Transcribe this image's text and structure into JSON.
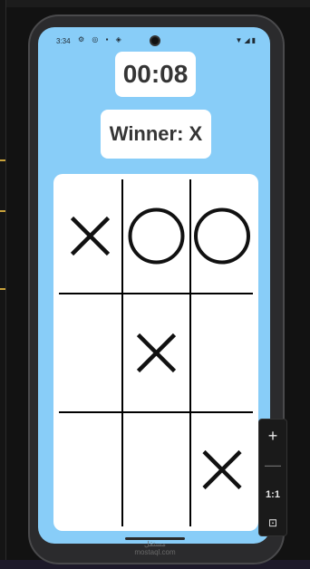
{
  "status_bar": {
    "time": "3:34"
  },
  "game": {
    "timer": "00:08",
    "winner": "Winner: X",
    "board": [
      [
        "X",
        "O",
        "O"
      ],
      [
        "",
        "X",
        ""
      ],
      [
        "",
        "",
        "X"
      ]
    ]
  },
  "watermark": "مستقل\nmostaql.com",
  "zoom_panel": {
    "ratio_label": "1:1"
  },
  "colors": {
    "screen_bg": "#88cdf8",
    "card_bg": "#ffffff",
    "text": "#353535",
    "mark": "#111111"
  },
  "icons": [
    "wifi-icon",
    "signal-icon",
    "battery-icon",
    "camera-icon",
    "plus-icon",
    "minus-icon",
    "fit-screen-icon"
  ]
}
